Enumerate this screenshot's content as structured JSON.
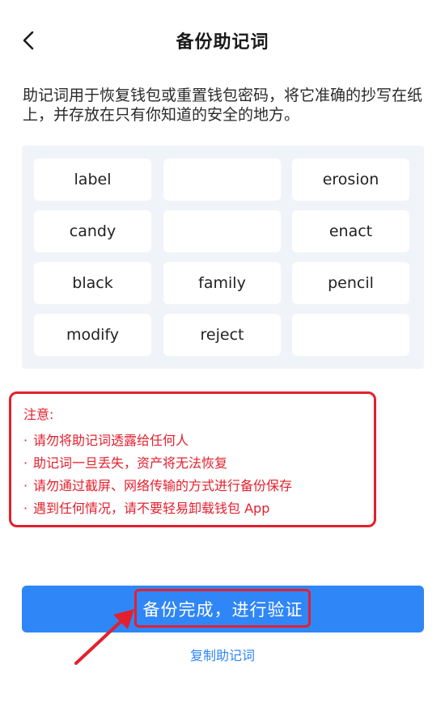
{
  "header": {
    "title": "备份助记词",
    "back_icon": "chevron-left-icon"
  },
  "instruction": "助记词用于恢复钱包或重置钱包密码，将它准确的抄写在纸上，并存放在只有你知道的安全的地方。",
  "mnemonic": {
    "words": [
      "label",
      "",
      "erosion",
      "candy",
      "",
      "enact",
      "black",
      "family",
      "pencil",
      "modify",
      "reject",
      ""
    ]
  },
  "notice": {
    "title": "注意:",
    "items": [
      "请勿将助记词透露给任何人",
      "助记词一旦丢失，资产将无法恢复",
      "请勿通过截屏、网络传输的方式进行备份保存",
      "遇到任何情况，请不要轻易卸载钱包 App"
    ],
    "bullet": "·"
  },
  "actions": {
    "confirm_label": "备份完成，进行验证",
    "copy_label": "复制助记词"
  },
  "colors": {
    "accent": "#2f86f6",
    "alert": "#e3202e",
    "panel": "#f0f4f9"
  }
}
